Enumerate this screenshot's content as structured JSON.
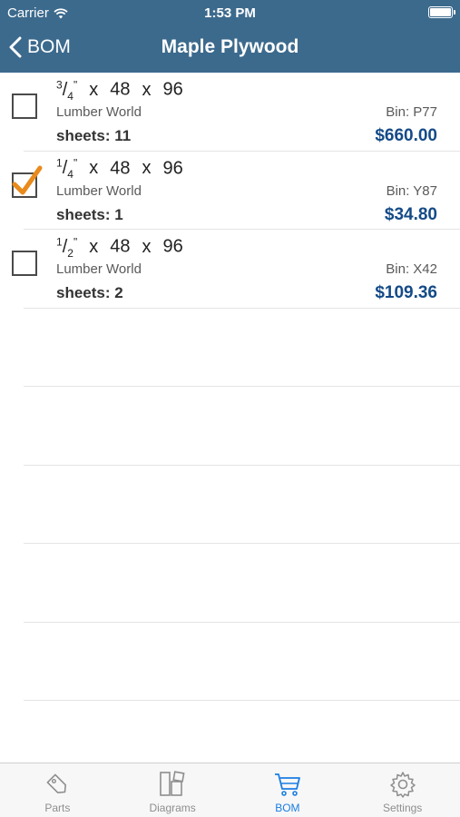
{
  "status_bar": {
    "carrier": "Carrier",
    "time": "1:53 PM"
  },
  "nav": {
    "back_label": "BOM",
    "title": "Maple Plywood"
  },
  "items": [
    {
      "frac_num": "3",
      "frac_den": "4",
      "inch_mark": "\"",
      "width": "48",
      "length": "96",
      "x": "x",
      "vendor": "Lumber World",
      "bin": "Bin: P77",
      "qty": "sheets: 11",
      "price": "$660.00",
      "checked": false
    },
    {
      "frac_num": "1",
      "frac_den": "4",
      "inch_mark": "\"",
      "width": "48",
      "length": "96",
      "x": "x",
      "vendor": "Lumber World",
      "bin": "Bin: Y87",
      "qty": "sheets: 1",
      "price": "$34.80",
      "checked": true
    },
    {
      "frac_num": "1",
      "frac_den": "2",
      "inch_mark": "\"",
      "width": "48",
      "length": "96",
      "x": "x",
      "vendor": "Lumber World",
      "bin": "Bin: X42",
      "qty": "sheets: 2",
      "price": "$109.36",
      "checked": false
    }
  ],
  "tabs": [
    {
      "label": "Parts",
      "icon": "tag-icon"
    },
    {
      "label": "Diagrams",
      "icon": "diagrams-icon"
    },
    {
      "label": "BOM",
      "icon": "cart-icon",
      "active": true
    },
    {
      "label": "Settings",
      "icon": "gear-icon"
    }
  ],
  "colors": {
    "nav_bar": "#3c6a8d",
    "price": "#144a87",
    "check": "#e98a1c",
    "active_tab": "#1a7ee3"
  }
}
